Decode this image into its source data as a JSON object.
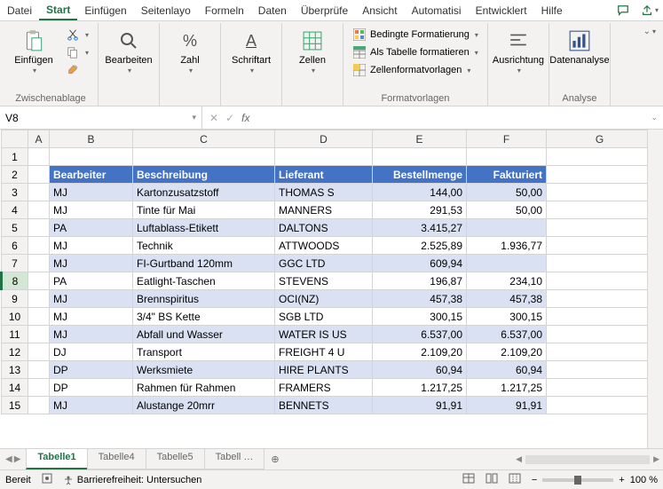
{
  "menu": {
    "tabs": [
      "Datei",
      "Start",
      "Einfügen",
      "Seitenlayo",
      "Formeln",
      "Daten",
      "Überprüfe",
      "Ansicht",
      "Automatisi",
      "Entwicklert",
      "Hilfe"
    ],
    "active": 1
  },
  "ribbon": {
    "paste": "Einfügen",
    "clipboard_label": "Zwischenablage",
    "edit": "Bearbeiten",
    "number": "Zahl",
    "font": "Schriftart",
    "cells": "Zellen",
    "cond_format": "Bedingte Formatierung",
    "as_table": "Als Tabelle formatieren",
    "cell_styles": "Zellenformatvorlagen",
    "styles_label": "Formatvorlagen",
    "alignment": "Ausrichtung",
    "data_analysis": "Datenanalyse",
    "analysis_label": "Analyse"
  },
  "name_box": "V8",
  "sheet": {
    "cols": [
      "A",
      "B",
      "C",
      "D",
      "E",
      "F",
      "G"
    ],
    "header_row": 2,
    "selected_row": 8,
    "headers": {
      "B": "Bearbeiter",
      "C": "Beschreibung",
      "D": "Lieferant",
      "E": "Bestellmenge",
      "F": "Fakturiert"
    },
    "rows": [
      {
        "n": 3,
        "B": "MJ",
        "C": "Kartonzusatzstoff",
        "D": "THOMAS S",
        "E": "144,00",
        "F": "50,00"
      },
      {
        "n": 4,
        "B": "MJ",
        "C": "Tinte für Mai",
        "D": "MANNERS",
        "E": "291,53",
        "F": "50,00"
      },
      {
        "n": 5,
        "B": "PA",
        "C": "Luftablass-Etikett",
        "D": "DALTONS",
        "E": "3.415,27",
        "F": ""
      },
      {
        "n": 6,
        "B": "MJ",
        "C": "Technik",
        "D": "ATTWOODS",
        "E": "2.525,89",
        "F": "1.936,77"
      },
      {
        "n": 7,
        "B": "MJ",
        "C": "FI-Gurtband 120mm",
        "D": "GGC LTD",
        "E": "609,94",
        "F": ""
      },
      {
        "n": 8,
        "B": "PA",
        "C": "Eatlight-Taschen",
        "D": "STEVENS",
        "E": "196,87",
        "F": "234,10"
      },
      {
        "n": 9,
        "B": "MJ",
        "C": "Brennspiritus",
        "D": "OCI(NZ)",
        "E": "457,38",
        "F": "457,38"
      },
      {
        "n": 10,
        "B": "MJ",
        "C": "3/4\" BS Kette",
        "D": "SGB LTD",
        "E": "300,15",
        "F": "300,15"
      },
      {
        "n": 11,
        "B": "MJ",
        "C": "Abfall und Wasser",
        "D": "WATER IS US",
        "E": "6.537,00",
        "F": "6.537,00"
      },
      {
        "n": 12,
        "B": "DJ",
        "C": "Transport",
        "D": "FREIGHT 4 U",
        "E": "2.109,20",
        "F": "2.109,20"
      },
      {
        "n": 13,
        "B": "DP",
        "C": "Werksmiete",
        "D": "HIRE PLANTS",
        "E": "60,94",
        "F": "60,94"
      },
      {
        "n": 14,
        "B": "DP",
        "C": "Rahmen für Rahmen",
        "D": "FRAMERS",
        "E": "1.217,25",
        "F": "1.217,25"
      },
      {
        "n": 15,
        "B": "MJ",
        "C": "Alustange 20mrr",
        "D": "BENNETS",
        "E": "91,91",
        "F": "91,91"
      }
    ]
  },
  "sheets": {
    "tabs": [
      "Tabelle1",
      "Tabelle4",
      "Tabelle5",
      "Tabell …"
    ],
    "active": 0
  },
  "status": {
    "ready": "Bereit",
    "access": "Barrierefreiheit: Untersuchen",
    "zoom": "100 %"
  }
}
